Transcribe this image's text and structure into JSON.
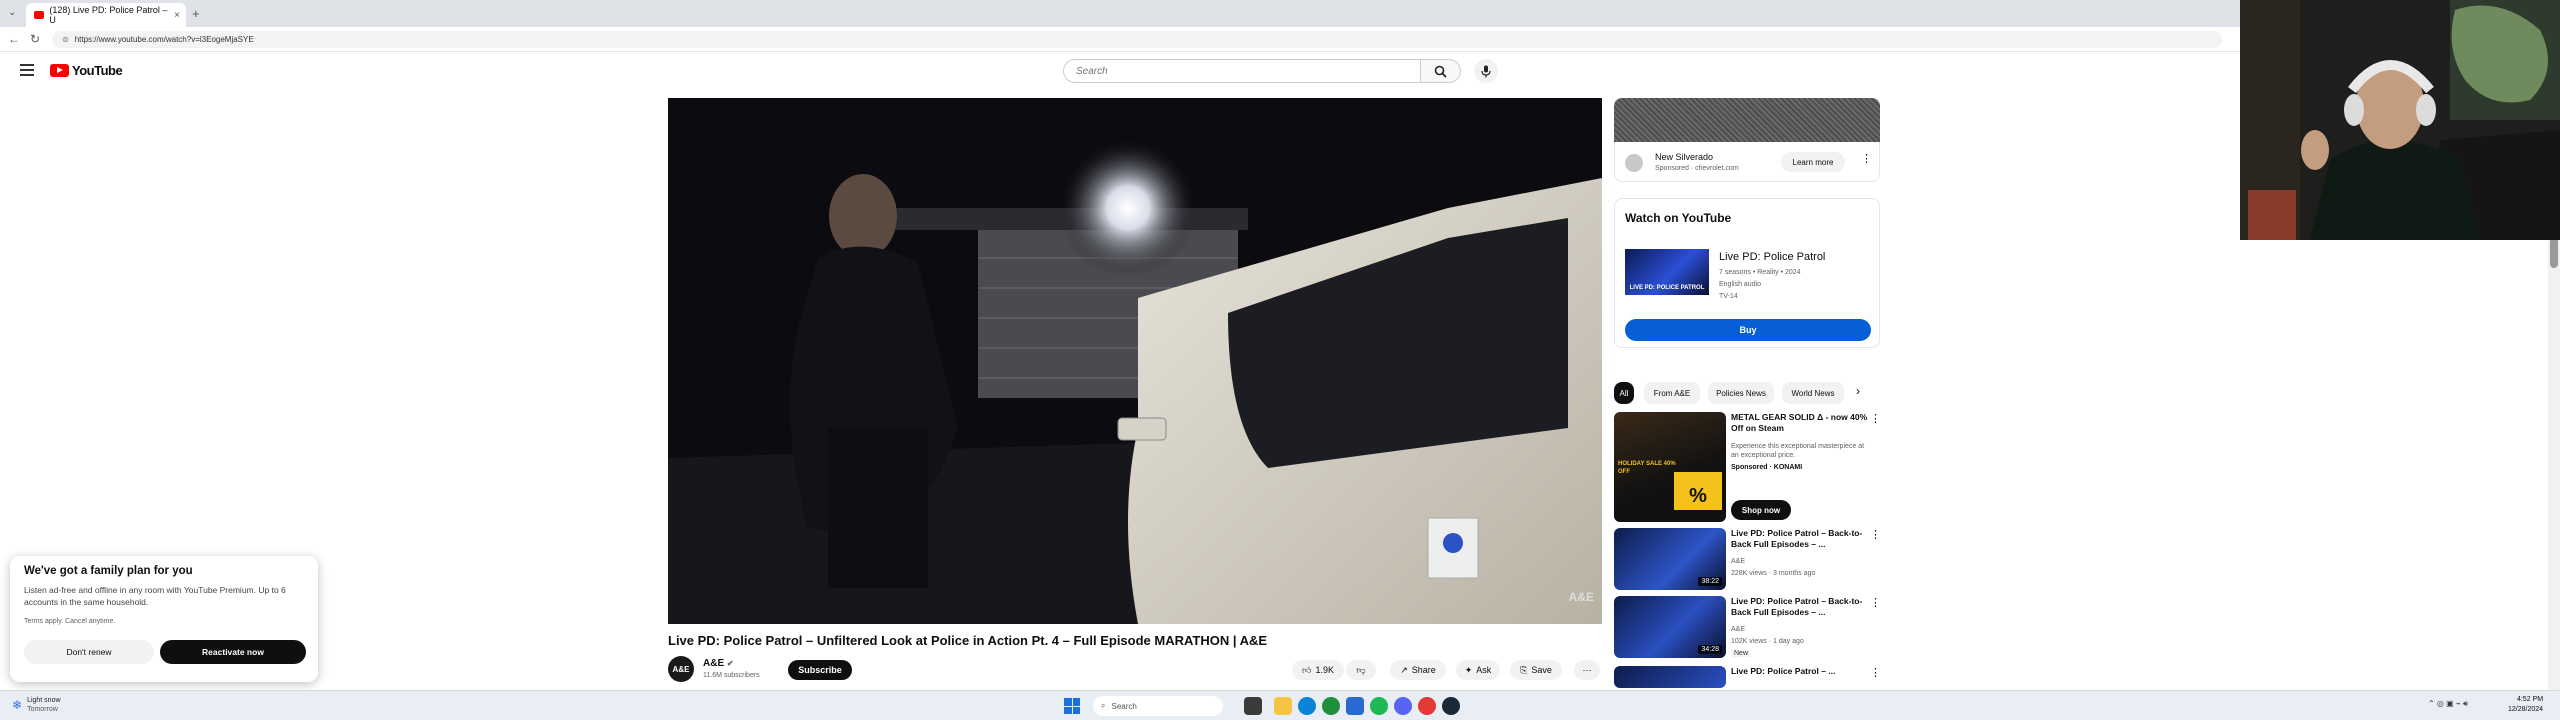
{
  "browser": {
    "tab_title": "(128) Live PD: Police Patrol – U",
    "close_glyph": "×",
    "new_tab_glyph": "+",
    "url": "https://www.youtube.com/watch?v=l3EogeMjaSYE"
  },
  "header": {
    "logo_text": "YouTube",
    "search_placeholder": "Search"
  },
  "video": {
    "watermark": "A&E",
    "title": "Live PD: Police Patrol – Unfiltered Look at Police in Action Pt. 4 – Full Episode MARATHON | A&E",
    "channel_name": "A&E",
    "channel_avatar_text": "A&E",
    "subscribers": "11.6M subscribers",
    "subscribe_label": "Subscribe",
    "likes": "1.9K",
    "share_label": "Share",
    "ask_label": "Ask",
    "save_label": "Save",
    "more_glyph": "⋯"
  },
  "ad": {
    "name": "New Silverado",
    "sponsor": "Sponsored · chevrolet.com",
    "learn_more": "Learn more"
  },
  "watch_card": {
    "heading": "Watch on YouTube",
    "thumb_text": "LIVE PD: POLICE PATROL",
    "show_title": "Live PD: Police Patrol",
    "meta1": "7 seasons • Reality • 2024",
    "meta2": "English audio",
    "meta3": "TV-14",
    "buy_label": "Buy"
  },
  "chips": [
    "All",
    "From A&E",
    "Policies News",
    "World News"
  ],
  "recommendations": [
    {
      "title": "METAL GEAR SOLID Δ - now 40% Off on Steam",
      "line1": "Experience this exceptional masterpiece at an exceptional price.",
      "line2": "Sponsored · KONAMI",
      "cta": "Shop now",
      "thumb_text": "HOLIDAY SALE 40% OFF"
    },
    {
      "title": "Live PD: Police Patrol – Back-to-Back Full Episodes – ...",
      "line1": "A&E",
      "line2": "228K views · 3 months ago",
      "duration": "38:22"
    },
    {
      "title": "Live PD: Police Patrol – Back-to-Back Full Episodes – ...",
      "line1": "A&E",
      "line2": "102K views · 1 day ago",
      "badge": "New",
      "duration": "34:28"
    },
    {
      "title": "Live PD: Police Patrol – ..."
    }
  ],
  "promo": {
    "title": "We've got a family plan for you",
    "body": "Listen ad-free and offline in any room with YouTube Premium. Up to 6 accounts in the same household.",
    "terms": "Terms apply. Cancel anytime.",
    "dont_renew": "Don't renew",
    "reactivate": "Reactivate now"
  },
  "taskbar": {
    "weather_line1": "Light snow",
    "weather_line2": "Tomorrow",
    "search_label": "Search",
    "time": "4:52 PM",
    "date": "12/28/2024"
  },
  "colors": {
    "youtube_red": "#ff0000",
    "buy_blue": "#065fd4"
  }
}
